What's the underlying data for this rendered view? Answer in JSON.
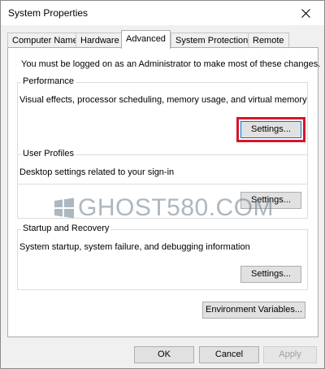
{
  "window": {
    "title": "System Properties"
  },
  "tabs": [
    {
      "label": "Computer Name"
    },
    {
      "label": "Hardware"
    },
    {
      "label": "Advanced",
      "active": true
    },
    {
      "label": "System Protection"
    },
    {
      "label": "Remote"
    }
  ],
  "advanced": {
    "admin_note": "You must be logged on as an Administrator to make most of these changes.",
    "performance": {
      "title": "Performance",
      "description": "Visual effects, processor scheduling, memory usage, and virtual memory",
      "settings_label": "Settings..."
    },
    "user_profiles": {
      "title": "User Profiles",
      "description": "Desktop settings related to your sign-in",
      "settings_label": "Settings..."
    },
    "startup_recovery": {
      "title": "Startup and Recovery",
      "description": "System startup, system failure, and debugging information",
      "settings_label": "Settings..."
    },
    "env_vars_label": "Environment Variables..."
  },
  "footer": {
    "ok_label": "OK",
    "cancel_label": "Cancel",
    "apply_label": "Apply"
  },
  "watermark": {
    "text": "GHOST580.COM"
  },
  "colors": {
    "highlight": "#d9142a",
    "panel": "#ffffff",
    "window_bg": "#f0f0f0"
  }
}
